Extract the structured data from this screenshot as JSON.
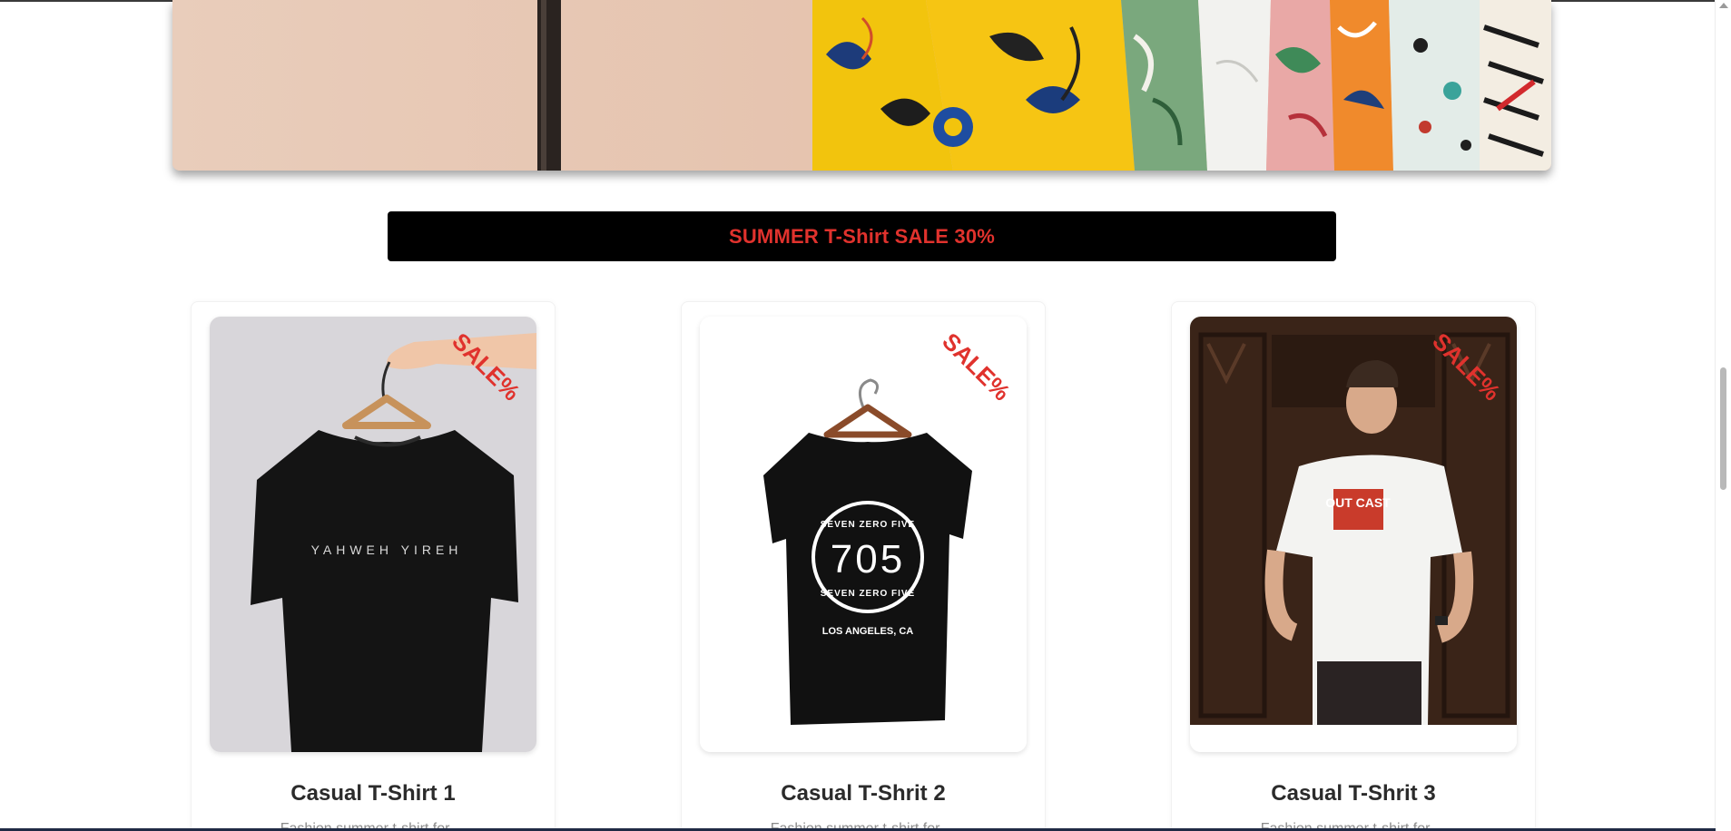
{
  "hero": {
    "alt": "Colorful summer shirts on a clothing rack"
  },
  "sale_bar": {
    "text": "SUMMER T-Shirt SALE 30%"
  },
  "products": [
    {
      "name": "Casual T-Shirt 1",
      "sale_tag": "SALE%",
      "shirt_print": "YAHWEH YIREH",
      "description": "Fashion summer t-shirt for ..."
    },
    {
      "name": "Casual T-Shrit 2",
      "sale_tag": "SALE%",
      "shirt_print_top": "SEVEN ZERO FIVE",
      "shirt_print_number": "705",
      "shirt_print_bottom": "SEVEN ZERO FIVE",
      "shirt_print_city": "LOS ANGELES, CA",
      "description": "Fashion summer t-shirt for ..."
    },
    {
      "name": "Casual T-Shrit 3",
      "sale_tag": "SALE%",
      "shirt_print": "OUT CAST",
      "description": "Fashion summer t-shirt for ..."
    }
  ],
  "colors": {
    "sale_red": "#e0322d",
    "sale_bar_bg": "#000000",
    "title_text": "#2b2b2b"
  }
}
